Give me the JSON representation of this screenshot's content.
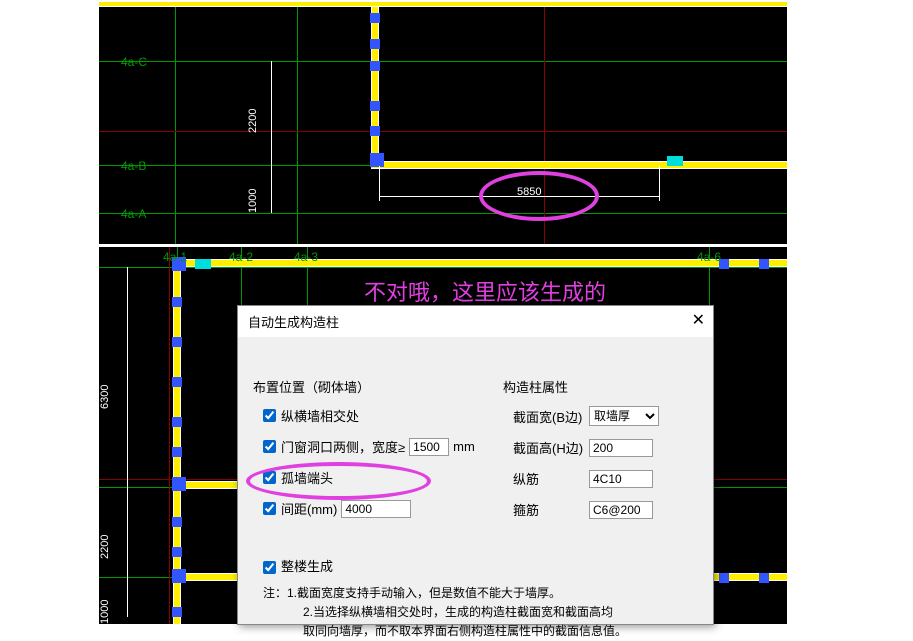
{
  "cad_top": {
    "labels": {
      "4a_c": "4a-C",
      "4a_b": "4a-B",
      "4a_a": "4a-A"
    },
    "dims": {
      "v_2200": "2200",
      "v_1000": "1000",
      "h_5850": "5850"
    }
  },
  "cad_bottom": {
    "labels": {
      "4a_1": "4a-1",
      "4a_2": "4a-2",
      "4a_3": "4a-3",
      "4a_6": "4a-6"
    },
    "dims": {
      "v_6300": "6300",
      "v_2200": "2200",
      "v_1000": "1000"
    }
  },
  "annotation_text": "不对哦，这里应该生成的",
  "dialog": {
    "title": "自动生成构造柱",
    "section_left": "布置位置（砌体墙）",
    "section_right": "构造柱属性",
    "cb_intersect": "纵横墙相交处",
    "cb_opening": "门窗洞口两侧，宽度≥",
    "opening_value": "1500",
    "opening_unit": "mm",
    "cb_endwall": "孤墙端头",
    "cb_spacing": "间距(mm)",
    "spacing_value": "4000",
    "attr_width_label": "截面宽(B边)",
    "attr_width_value": "取墙厚",
    "attr_height_label": "截面高(H边)",
    "attr_height_value": "200",
    "attr_longbar_label": "纵筋",
    "attr_longbar_value": "4C10",
    "attr_stirrup_label": "箍筋",
    "attr_stirrup_value": "C6@200",
    "cb_whole": "整楼生成",
    "note1": "注：1.截面宽度支持手动输入，但是数值不能大于墙厚。",
    "note2": "2.当选择纵横墙相交处时，生成的构造柱截面宽和截面高均",
    "note3": "取同向墙厚，而不取本界面右侧构造柱属性中的截面信息值。"
  }
}
